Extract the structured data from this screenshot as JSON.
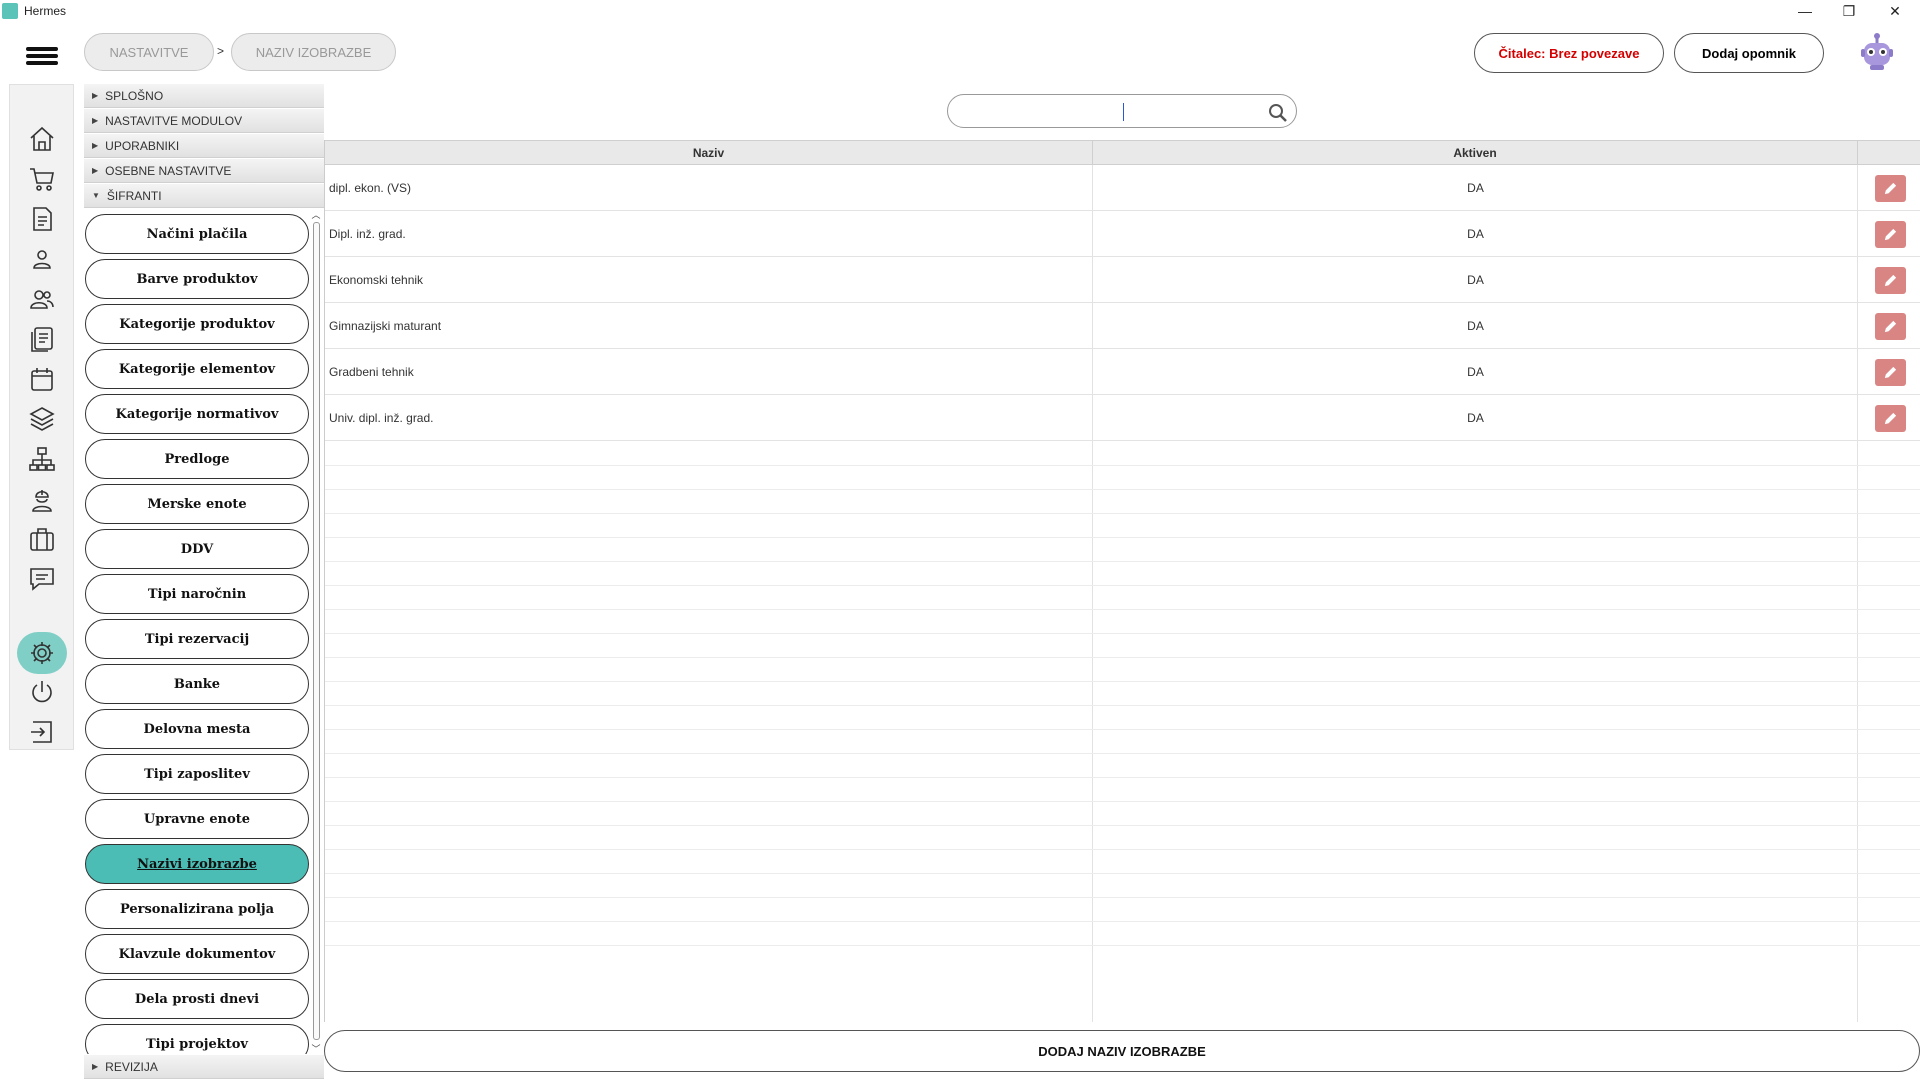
{
  "window": {
    "title": "Hermes",
    "controls": [
      "—",
      "❐",
      "✕"
    ]
  },
  "header": {
    "breadcrumb": [
      "NASTAVITVE",
      "NAZIV IZOBRAZBE"
    ],
    "separator": ">",
    "reader_button": "Čitalec: Brez povezave",
    "reminder_button": "Dodaj opomnik"
  },
  "colors": {
    "accent": "#4bbdb4",
    "reader_text": "#d40000",
    "edit_button": "#d98584",
    "rail_active": "#7fcfc6"
  },
  "rail_icons": [
    "home-icon",
    "cart-icon",
    "invoice-icon",
    "person-icon",
    "users-icon",
    "documents-icon",
    "calendar-icon",
    "layers-icon",
    "org-chart-icon",
    "worker-icon",
    "briefcase-icon",
    "chat-icon",
    "gear-icon",
    "power-icon",
    "logout-icon"
  ],
  "sections": {
    "splosno": "SPLOŠNO",
    "moduli": "NASTAVITVE MODULOV",
    "uporabniki": "UPORABNIKI",
    "osebne": "OSEBNE NASTAVITVE",
    "sifranti": "ŠIFRANTI",
    "revizija": "REVIZIJA"
  },
  "sifranti_items": [
    "Načini plačila",
    "Barve produktov",
    "Kategorije produktov",
    "Kategorije elementov",
    "Kategorije normativov",
    "Predloge",
    "Merske enote",
    "DDV",
    "Tipi naročnin",
    "Tipi rezervacij",
    "Banke",
    "Delovna mesta",
    "Tipi zaposlitev",
    "Upravne enote",
    "Nazivi izobrazbe",
    "Personalizirana polja",
    "Klavzule dokumentov",
    "Dela prosti dnevi",
    "Tipi projektov"
  ],
  "active_item": "Nazivi izobrazbe",
  "search": {
    "value": ""
  },
  "table": {
    "columns": [
      "Naziv",
      "Aktiven"
    ],
    "rows": [
      {
        "naziv": "dipl. ekon. (VS)",
        "aktiven": "DA"
      },
      {
        "naziv": "Dipl. inž. grad.",
        "aktiven": "DA"
      },
      {
        "naziv": "Ekonomski tehnik",
        "aktiven": "DA"
      },
      {
        "naziv": "Gimnazijski maturant",
        "aktiven": "DA"
      },
      {
        "naziv": "Gradbeni tehnik",
        "aktiven": "DA"
      },
      {
        "naziv": "Univ. dipl. inž. grad.",
        "aktiven": "DA"
      }
    ]
  },
  "add_button": "DODAJ NAZIV IZOBRAZBE"
}
